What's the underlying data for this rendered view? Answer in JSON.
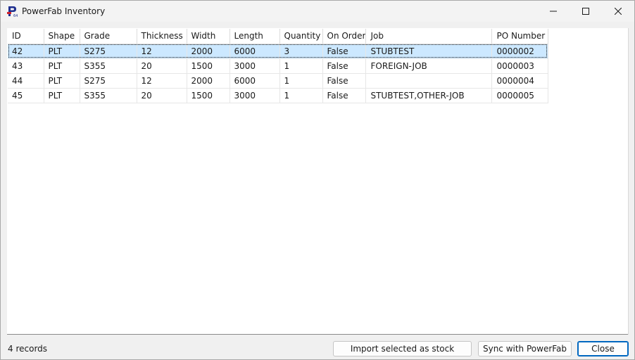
{
  "window": {
    "title": "PowerFab Inventory",
    "icon": "powerfab-app-icon",
    "controls": {
      "minimize": "minimize-icon",
      "maximize": "maximize-icon",
      "close": "close-icon"
    }
  },
  "grid": {
    "columns": [
      "ID",
      "Shape",
      "Grade",
      "Thickness",
      "Width",
      "Length",
      "Quantity",
      "On Order",
      "Job",
      "PO Number"
    ],
    "rows": [
      [
        "42",
        "PLT",
        "S275",
        "12",
        "2000",
        "6000",
        "3",
        "False",
        "STUBTEST",
        "0000002"
      ],
      [
        "43",
        "PLT",
        "S355",
        "20",
        "1500",
        "3000",
        "1",
        "False",
        "FOREIGN-JOB",
        "0000003"
      ],
      [
        "44",
        "PLT",
        "S275",
        "12",
        "2000",
        "6000",
        "1",
        "False",
        "",
        "0000004"
      ],
      [
        "45",
        "PLT",
        "S355",
        "20",
        "1500",
        "3000",
        "1",
        "False",
        "STUBTEST,OTHER-JOB",
        "0000005"
      ]
    ],
    "selected_row_id": "42"
  },
  "status": {
    "record_count_text": "4 records"
  },
  "buttons": {
    "import_label": "Import selected as stock",
    "sync_label": "Sync with PowerFab",
    "close_label": "Close"
  },
  "colors": {
    "selection": "#cce8ff",
    "default_button_border": "#0067c0"
  }
}
